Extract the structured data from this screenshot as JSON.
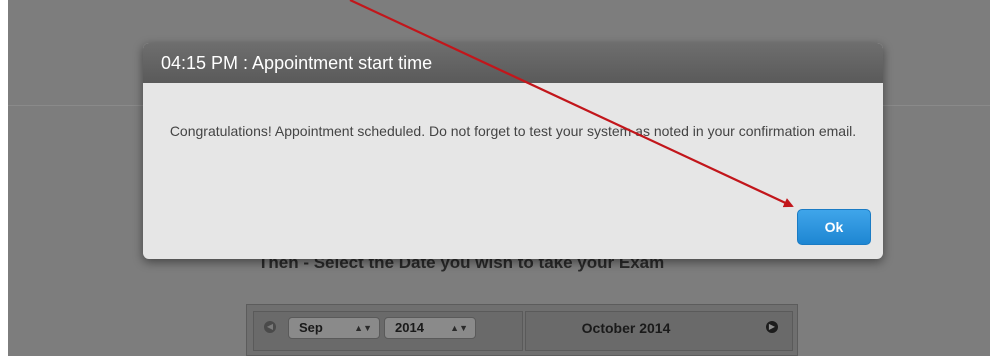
{
  "modal": {
    "title": "04:15 PM : Appointment start time",
    "message": "Congratulations! Appointment scheduled. Do not forget to test your system as noted in your confirmation email.",
    "ok_label": "Ok",
    "ok_color": "#2a93df"
  },
  "background": {
    "heading": "Then - Select the Date you wish to take your Exam",
    "calendar": {
      "month_value": "Sep",
      "year_value": "2014",
      "right_title": "October 2014",
      "prev_icon": "circle-left-icon",
      "next_icon": "circle-right-icon"
    }
  },
  "annotation": {
    "arrow_color": "#c2161b"
  }
}
